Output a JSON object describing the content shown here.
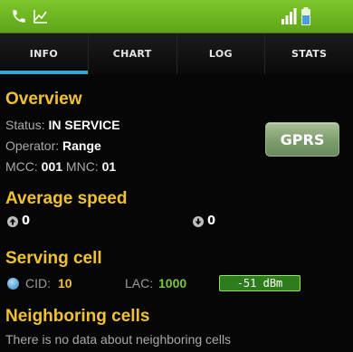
{
  "status_bar": {
    "left_icons": [
      "phone-icon",
      "chart-icon"
    ],
    "right_icons": [
      "signal-icon",
      "battery-icon"
    ],
    "accent_color": "#6cb521"
  },
  "tabs": [
    {
      "label": "INFO",
      "active": true
    },
    {
      "label": "CHART",
      "active": false
    },
    {
      "label": "LOG",
      "active": false
    },
    {
      "label": "STATS",
      "active": false
    }
  ],
  "overview": {
    "title": "Overview",
    "status_label": "Status:",
    "status_value": "IN SERVICE",
    "operator_label": "Operator:",
    "operator_value": "Range",
    "mcc_label": "MCC:",
    "mcc_value": "001",
    "mnc_label": "MNC:",
    "mnc_value": "01",
    "network_button": "GPRS"
  },
  "average_speed": {
    "title": "Average speed",
    "upload_value": "0",
    "download_value": "0"
  },
  "serving_cell": {
    "title": "Serving cell",
    "cid_label": "CID:",
    "cid_value": "10",
    "lac_label": "LAC:",
    "lac_value": "1000",
    "signal": "-51  dBm"
  },
  "neighboring_cells": {
    "title": "Neighboring cells",
    "message": "There is no data about neighboring cells"
  },
  "colors": {
    "section_title": "#f0c231",
    "active_tab": "#3aa3d8",
    "signal_badge": "#2e7d1c"
  }
}
